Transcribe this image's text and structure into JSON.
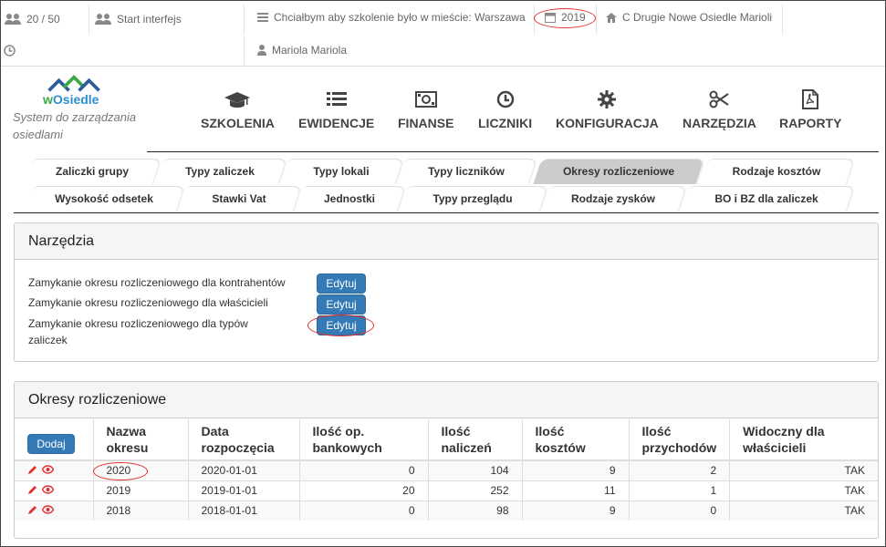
{
  "topbar": {
    "counter": "20 / 50",
    "start_label": "Start interfejs",
    "training_location": "Chciałbym aby szkolenie było w mieście: Warszawa",
    "year": "2019",
    "estate": "C Drugie Nowe Osiedle Marioli",
    "user": "Mariola Mariola"
  },
  "brand": {
    "name_prefix": "w",
    "name_rest": "Osiedle",
    "tagline": "System do zarządzania osiedlami"
  },
  "nav": [
    {
      "label": "SZKOLENIA",
      "icon": "graduation-cap-icon"
    },
    {
      "label": "EWIDENCJE",
      "icon": "list-icon"
    },
    {
      "label": "FINANSE",
      "icon": "money-icon"
    },
    {
      "label": "LICZNIKI",
      "icon": "clock-icon"
    },
    {
      "label": "KONFIGURACJA",
      "icon": "gear-icon"
    },
    {
      "label": "NARZĘDZIA",
      "icon": "scissors-icon"
    },
    {
      "label": "RAPORTY",
      "icon": "pdf-file-icon"
    }
  ],
  "tabs_row1": [
    "Zaliczki grupy",
    "Typy zaliczek",
    "Typy lokali",
    "Typy liczników",
    "Okresy rozliczeniowe",
    "Rodzaje kosztów"
  ],
  "tabs_row2": [
    "Wysokość odsetek",
    "Stawki Vat",
    "Jednostki",
    "Typy przeglądu",
    "Rodzaje zysków",
    "BO i BZ dla zaliczek"
  ],
  "active_tab": "Okresy rozliczeniowe",
  "tools": {
    "title": "Narzędzia",
    "rows": [
      {
        "label": "Zamykanie okresu rozliczeniowego dla kontrahentów",
        "button": "Edytuj"
      },
      {
        "label": "Zamykanie okresu rozliczeniowego dla właścicieli",
        "button": "Edytuj"
      },
      {
        "label": "Zamykanie okresu rozliczeniowego dla typów zaliczek",
        "button": "Edytuj"
      }
    ]
  },
  "periods": {
    "title": "Okresy rozliczeniowe",
    "add_button": "Dodaj",
    "columns": [
      "Nazwa okresu",
      "Data rozpoczęcia",
      "Ilość op. bankowych",
      "Ilość naliczeń",
      "Ilość kosztów",
      "Ilość przychodów",
      "Widoczny dla właścicieli"
    ],
    "rows": [
      {
        "name": "2020",
        "start": "2020-01-01",
        "bank_ops": "0",
        "charges": "104",
        "costs": "9",
        "revenues": "2",
        "visible": "TAK"
      },
      {
        "name": "2019",
        "start": "2019-01-01",
        "bank_ops": "20",
        "charges": "252",
        "costs": "11",
        "revenues": "1",
        "visible": "TAK"
      },
      {
        "name": "2018",
        "start": "2018-01-01",
        "bank_ops": "0",
        "charges": "98",
        "costs": "9",
        "revenues": "0",
        "visible": "TAK"
      }
    ]
  },
  "colors": {
    "primary_button": "#337ab7",
    "annotation": "#e03030",
    "edit_icon": "#e03030",
    "active_tab": "#cccccc"
  }
}
